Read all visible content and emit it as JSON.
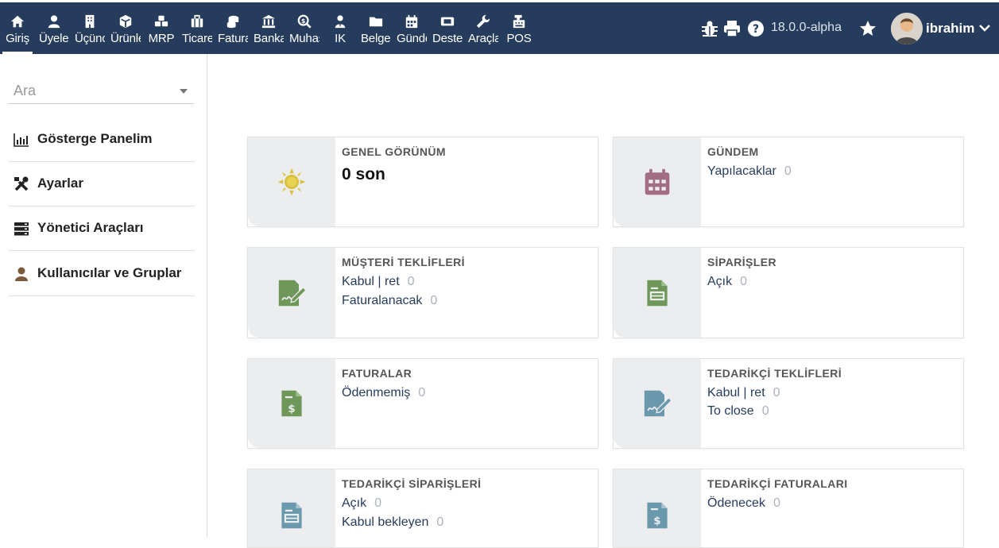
{
  "topnav": {
    "items": [
      {
        "label": "Giriş",
        "icon": "home-icon"
      },
      {
        "label": "Üyeler",
        "icon": "user-icon"
      },
      {
        "label": "Üçüncü",
        "icon": "building-icon"
      },
      {
        "label": "Ürünler",
        "icon": "cube-icon"
      },
      {
        "label": "MRP",
        "icon": "cubes-icon"
      },
      {
        "label": "Ticaret",
        "icon": "suitcase-icon"
      },
      {
        "label": "Faturalar",
        "icon": "coins-icon"
      },
      {
        "label": "Banka",
        "icon": "bank-icon"
      },
      {
        "label": "Muhasebe",
        "icon": "search-dollar-icon"
      },
      {
        "label": "IK",
        "icon": "user-tie-icon"
      },
      {
        "label": "Belgeler",
        "icon": "folder-icon"
      },
      {
        "label": "Gündem",
        "icon": "calendar-icon"
      },
      {
        "label": "Destek",
        "icon": "ticket-icon"
      },
      {
        "label": "Araçlar",
        "icon": "wrench-icon"
      },
      {
        "label": "POS",
        "icon": "cash-register-icon"
      }
    ],
    "version": "18.0.0-alpha",
    "username": "ibrahim"
  },
  "sidebar": {
    "search_placeholder": "Ara",
    "items": [
      {
        "label": "Gösterge Panelim",
        "icon": "chart-icon"
      },
      {
        "label": "Ayarlar",
        "icon": "tools-icon"
      },
      {
        "label": "Yönetici Araçları",
        "icon": "server-icon"
      },
      {
        "label": "Kullanıcılar ve Gruplar",
        "icon": "user-icon"
      }
    ]
  },
  "cards": {
    "overview": {
      "title": "GENEL GÖRÜNÜM",
      "value": "0 son"
    },
    "agenda": {
      "title": "GÜNDEM",
      "lines": [
        {
          "label": "Yapılacaklar",
          "count": "0"
        }
      ]
    },
    "proposals": {
      "title": "MÜŞTERİ TEKLİFLERİ",
      "lines": [
        {
          "label": "Kabul | ret",
          "count": "0"
        },
        {
          "label": "Faturalanacak",
          "count": "0"
        }
      ]
    },
    "orders": {
      "title": "SİPARİŞLER",
      "lines": [
        {
          "label": "Açık",
          "count": "0"
        }
      ]
    },
    "invoices": {
      "title": "FATURALAR",
      "lines": [
        {
          "label": "Ödenmemiş",
          "count": "0"
        }
      ]
    },
    "supplier_proposals": {
      "title": "TEDARİKÇİ TEKLİFLERİ",
      "lines": [
        {
          "label": "Kabul | ret",
          "count": "0"
        },
        {
          "label": "To close",
          "count": "0"
        }
      ]
    },
    "supplier_orders": {
      "title": "TEDARİKÇİ SİPARİŞLERİ",
      "lines": [
        {
          "label": "Açık",
          "count": "0"
        },
        {
          "label": "Kabul bekleyen",
          "count": "0"
        }
      ]
    },
    "supplier_invoices": {
      "title": "TEDARİKÇİ FATURALARI",
      "lines": [
        {
          "label": "Ödenecek",
          "count": "0"
        }
      ]
    }
  },
  "colors": {
    "topbar": "#263c5c",
    "weather": "#d8c03a",
    "agenda": "#a26d83",
    "customer_green": "#6e9759",
    "supplier_blue": "#6a99ad"
  }
}
